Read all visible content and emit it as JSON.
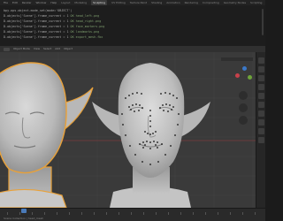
{
  "topbar": {
    "menus": [
      "File",
      "Edit",
      "Render",
      "Window",
      "Help"
    ],
    "workspaces": [
      "Layout",
      "Modeling",
      "Sculpting",
      "UV Editing",
      "Texture Paint",
      "Shading",
      "Animation",
      "Rendering",
      "Compositing",
      "Geometry Nodes",
      "Scripting"
    ],
    "active_workspace": "Sculpting"
  },
  "log": {
    "lines": [
      {
        "prefix": "bpy.ops.object.mode_set(mode='OBJECT')",
        "suffix": ""
      },
      {
        "prefix": "D.objects['Scene'].frame_current = 1",
        "suffix": "  OK  head_left.png"
      },
      {
        "prefix": "D.objects['Scene'].frame_current = 1",
        "suffix": "  OK  head_right.png"
      },
      {
        "prefix": "D.objects['Scene'].frame_current = 1",
        "suffix": "  OK  face_markers.png"
      },
      {
        "prefix": "D.objects['Scene'].frame_current = 1",
        "suffix": "  OK  landmarks.png"
      },
      {
        "prefix": "D.objects['Scene'].frame_current = 1",
        "suffix": "  OK  export_mesh.fbx"
      }
    ]
  },
  "viewport_header": {
    "mode": "Object Mode",
    "view": "View",
    "select": "Select",
    "add": "Add",
    "object": "Object"
  },
  "timeline": {
    "status": "Scene Collection | head_mesh",
    "frame": "1"
  },
  "colors": {
    "viewport_bg": "#3a3a3a",
    "selection_outline": "#e8a13a",
    "marker_dots": "#111111",
    "axis_x": "#c8414b",
    "axis_y": "#6ea53a",
    "axis_z": "#3b78c8"
  }
}
